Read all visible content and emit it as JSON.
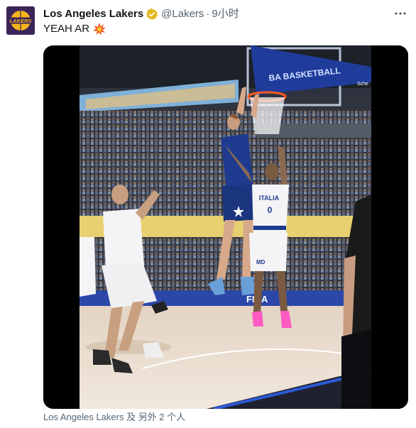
{
  "tweet": {
    "display_name": "Los Angeles Lakers",
    "handle": "@Lakers",
    "separator": "·",
    "time": "9小时",
    "text": "YEAH AR",
    "emoji": "collision-emoji",
    "verified_icon": "verified-badge-icon",
    "more_icon": "more-horizontal-icon",
    "tagged_text": "Los Angeles Lakers 及 另外 2 个人",
    "avatar_text": "LAKERS"
  },
  "media": {
    "type": "video",
    "banner_text": "BA BASKETBALL",
    "jersey_number": "0",
    "jersey_text": "ITALIA",
    "ad_text": "MD",
    "court_text": "FIBA",
    "small_text": "Sche"
  },
  "colors": {
    "lakers_purple": "#3a2459",
    "lakers_gold": "#f7b51c",
    "verified_gold": "#e2b719",
    "muted": "#536471",
    "usa_blue": "#1e3b8f",
    "court_floor": "#e9ddd0"
  }
}
